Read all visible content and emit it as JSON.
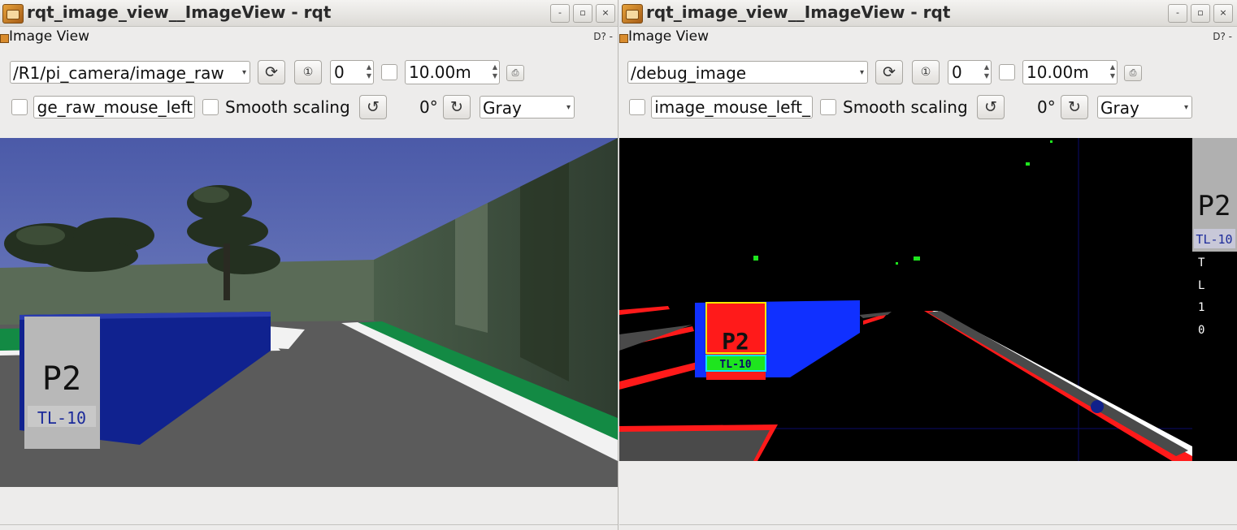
{
  "left_window": {
    "title": "rqt_image_view__ImageView - rqt",
    "window_buttons": {
      "minimize": "-",
      "maximize": "▫",
      "close": "×"
    },
    "dock_title": "Image View",
    "dock_controls": "D? -",
    "topic": "/R1/pi_camera/image_raw",
    "zoom_value": "0",
    "timeout_value": "10.00m",
    "mouse_topic": "ge_raw_mouse_left",
    "smooth_scaling_label": "Smooth scaling",
    "rotation": "0°",
    "color_scheme": "Gray",
    "sign": {
      "text": "P2",
      "plate": "TL-10"
    }
  },
  "right_window": {
    "title": "rqt_image_view__ImageView - rqt",
    "window_buttons": {
      "minimize": "-",
      "maximize": "▫",
      "close": "×"
    },
    "dock_title": "Image View",
    "dock_controls": "D? -",
    "topic": "/debug_image",
    "zoom_value": "0",
    "timeout_value": "10.00m",
    "mouse_topic": "_image_mouse_left",
    "smooth_scaling_label": "Smooth scaling",
    "rotation": "0°",
    "color_scheme": "Gray",
    "sign": {
      "text": "P2",
      "plate": "TL-10"
    },
    "crop_sign": {
      "text": "P2",
      "plate": "TL-10"
    },
    "vertical_readout": [
      "T",
      "L",
      "1",
      "0"
    ]
  },
  "colors": {
    "sky": "#5d6fb6",
    "road": "#5e5e5e",
    "grass": "#138a44",
    "sign_blue": "#10228f",
    "mask_red": "#ff1a1a",
    "mask_blue": "#1030ff",
    "mask_green": "#1ee51e"
  }
}
